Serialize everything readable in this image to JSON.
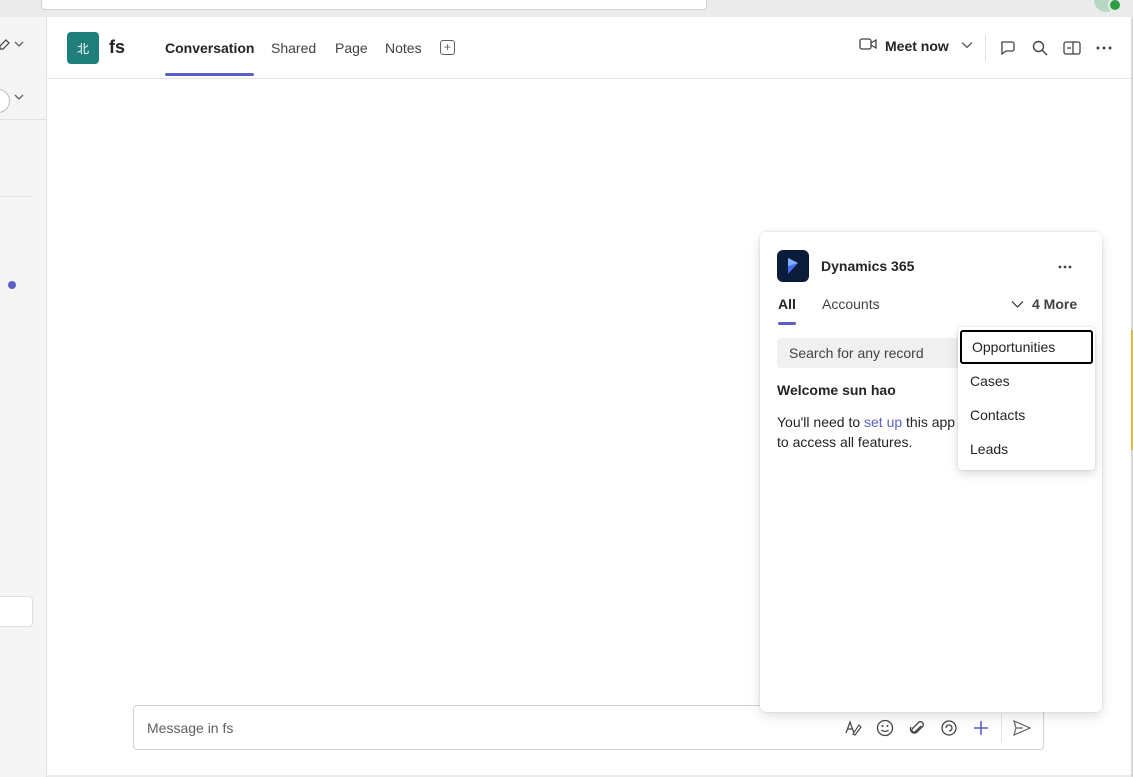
{
  "channel": {
    "avatar_glyph": "北",
    "name": "fs"
  },
  "tabs": [
    {
      "label": "Conversation",
      "active": true
    },
    {
      "label": "Shared"
    },
    {
      "label": "Page"
    },
    {
      "label": "Notes"
    }
  ],
  "header": {
    "meet_label": "Meet now"
  },
  "compose": {
    "placeholder": "Message in fs"
  },
  "app_card": {
    "title": "Dynamics 365",
    "tabs": {
      "all": "All",
      "accounts": "Accounts",
      "more": "4 More"
    },
    "search_placeholder": "Search for any record",
    "welcome": "Welcome sun hao",
    "setup_prefix": "You'll need to ",
    "setup_link": "set up",
    "setup_suffix": " this app to access all features."
  },
  "more_menu": {
    "items": [
      "Opportunities",
      "Cases",
      "Contacts",
      "Leads"
    ],
    "focused": "Opportunities"
  },
  "colors": {
    "accent": "#5b5fc7",
    "channel_avatar": "#1f7f7a",
    "d365_bg": "#0b1c3a"
  },
  "icons": [
    "compose-icon",
    "chevron-down-icon",
    "filter-icon",
    "video-camera-icon",
    "chat-icon",
    "search-icon",
    "side-panel-icon",
    "more-icon",
    "format-icon",
    "emoji-icon",
    "attach-icon",
    "loop-icon",
    "plus-icon",
    "send-icon"
  ]
}
